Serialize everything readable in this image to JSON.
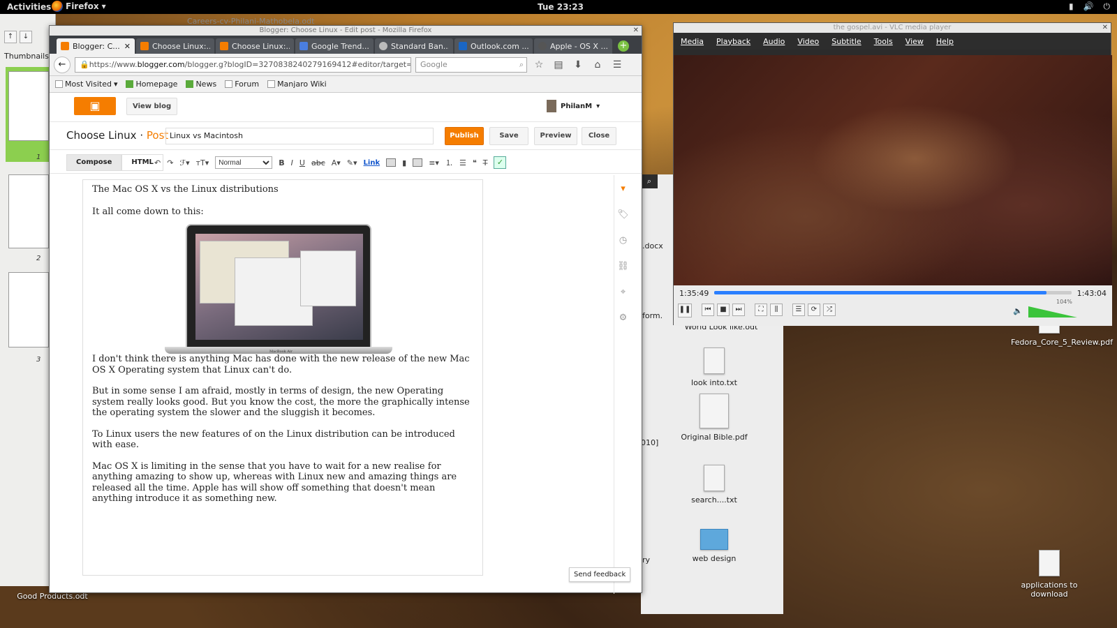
{
  "topbar": {
    "activities": "Activities",
    "app": "Firefox",
    "clock": "Tue 23:23"
  },
  "desktop": {
    "icons": [
      "look into.txt",
      "Original Bible.pdf",
      "search....txt",
      "web design",
      "Fedora_Core_5_Review.pdf",
      "applications to download",
      "Good Products.odt",
      "World Look like.odt"
    ],
    "nautilus_fragments": [
      ".docx",
      "form.",
      "010]",
      "ry"
    ]
  },
  "libreoffice": {
    "title": "Careers-cv-Philani-Mathobela.odt",
    "thumbnails_label": "Thumbnails",
    "pages": [
      "1",
      "2",
      "3"
    ]
  },
  "firefox": {
    "window_title": "Blogger: Choose Linux - Edit post - Mozilla Firefox",
    "tabs": [
      {
        "label": "Blogger: C...",
        "color": "#f57d00"
      },
      {
        "label": "Choose Linux:...",
        "color": "#f57d00"
      },
      {
        "label": "Choose Linux:...",
        "color": "#f57d00"
      },
      {
        "label": "Google Trend...",
        "color": "#4a7ee0"
      },
      {
        "label": "Standard Ban...",
        "color": "#bbb"
      },
      {
        "label": "Outlook.com ...",
        "color": "#1a66c4"
      },
      {
        "label": "Apple - OS X ...",
        "color": "#555"
      }
    ],
    "url_prefix": "https://www.",
    "url_host": "blogger.com",
    "url_rest": "/blogger.g?blogID=3270838240279169412#editor/target=po",
    "search_placeholder": "Google",
    "bookmarks": [
      "Most Visited",
      "Homepage",
      "News",
      "Forum",
      "Manjaro Wiki"
    ]
  },
  "blogger": {
    "view_blog": "View blog",
    "user": "PhilanM",
    "blog_name": "Choose Linux",
    "post_label": "Post",
    "post_title": "Linux vs Macintosh",
    "buttons": {
      "publish": "Publish",
      "save": "Save",
      "preview": "Preview",
      "close": "Close"
    },
    "modes": {
      "compose": "Compose",
      "html": "HTML"
    },
    "format": "Normal",
    "link": "Link",
    "content": {
      "line1": "The Mac OS X vs the Linux distributions",
      "line2": "It all come down to  this:",
      "macbook_label": "MacBook Air",
      "p1": "I don't think there is anything Mac has done with the new release of the new Mac OS X Operating system that Linux can't do.",
      "p2": "But in some sense I am afraid, mostly in terms of design, the new Operating system really looks good. But you know the cost, the more the graphically intense the operating system the slower and the sluggish it becomes.",
      "p3": "To Linux users the new features of on the Linux distribution can be introduced with ease.",
      "p4": "Mac OS X is limiting in the sense that you have to wait for a new realise for anything amazing to show up, whereas with Linux new and amazing things are released all the time. Apple has will show off something that doesn't mean anything introduce it as something new."
    },
    "send_feedback": "Send feedback"
  },
  "vlc": {
    "title": "the gospel.avi - VLC media player",
    "menu": [
      "Media",
      "Playback",
      "Audio",
      "Video",
      "Subtitle",
      "Tools",
      "View",
      "Help"
    ],
    "elapsed": "1:35:49",
    "total": "1:43:04",
    "progress": 0.93,
    "volume": "104%"
  }
}
